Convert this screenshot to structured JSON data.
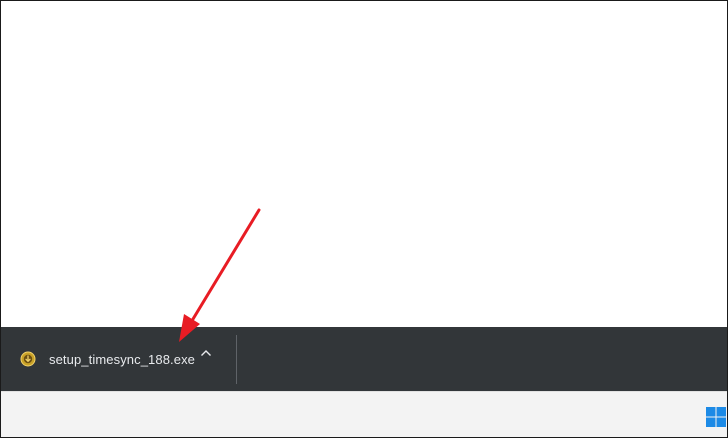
{
  "download_bar": {
    "item": {
      "file_name": "setup_timesync_188.exe",
      "icon": "installer-file-icon"
    },
    "menu_icon": "chevron-up-icon"
  },
  "taskbar": {
    "start_icon": "windows-start-icon",
    "accent_color": "#0078d4"
  },
  "annotation": {
    "color": "#e81c24"
  }
}
